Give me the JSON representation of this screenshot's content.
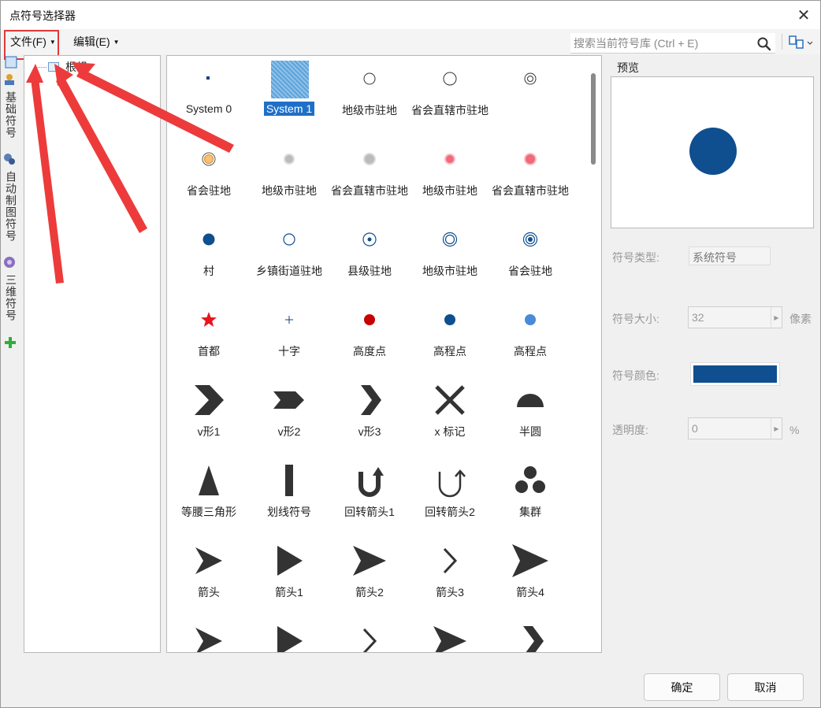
{
  "window": {
    "title": "点符号选择器",
    "close_glyph": "✕"
  },
  "menu": {
    "file": "文件(F)",
    "edit": "编辑(E)"
  },
  "search": {
    "placeholder": "搜索当前符号库 (Ctrl + E)"
  },
  "side_tabs": [
    {
      "label": "基础符号",
      "icon": "basic-symbol-icon"
    },
    {
      "label": "自动制图符号",
      "icon": "auto-mapping-icon"
    },
    {
      "label": "三维符号",
      "icon": "3d-symbol-icon"
    }
  ],
  "tree": {
    "root_label": "根组"
  },
  "symbols": [
    {
      "label": "System 0",
      "icon": "small-square",
      "selected": false
    },
    {
      "label": "System 1",
      "icon": "hatched-square",
      "selected": true
    },
    {
      "label": "地级市驻地",
      "icon": "circle-outline",
      "selected": false
    },
    {
      "label": "省会直辖市驻地",
      "icon": "circle-outline-large",
      "selected": false
    },
    {
      "label": "",
      "icon": "double-circle",
      "selected": false
    },
    {
      "label": "省会驻地",
      "icon": "orange-ring-circle",
      "selected": false
    },
    {
      "label": "地级市驻地",
      "icon": "gray-gradient-dot",
      "selected": false
    },
    {
      "label": "省会直辖市驻地",
      "icon": "gray-gradient-dot-large",
      "selected": false
    },
    {
      "label": "地级市驻地",
      "icon": "red-gradient-dot",
      "selected": false
    },
    {
      "label": "省会直辖市驻地",
      "icon": "red-gradient-dot-large",
      "selected": false
    },
    {
      "label": "村",
      "icon": "blue-filled-circle",
      "selected": false
    },
    {
      "label": "乡镇街道驻地",
      "icon": "blue-outline-circle",
      "selected": false
    },
    {
      "label": "县级驻地",
      "icon": "dot-in-circle",
      "selected": false
    },
    {
      "label": "地级市驻地",
      "icon": "concentric-circle",
      "selected": false
    },
    {
      "label": "省会驻地",
      "icon": "concentric-circle-dot",
      "selected": false
    },
    {
      "label": "首都",
      "icon": "red-star",
      "selected": false
    },
    {
      "label": "十字",
      "icon": "cross",
      "selected": false
    },
    {
      "label": "高度点",
      "icon": "red-dot",
      "selected": false
    },
    {
      "label": "高程点",
      "icon": "blue-dot",
      "selected": false
    },
    {
      "label": "高程点",
      "icon": "light-blue-dot",
      "selected": false
    },
    {
      "label": "v形1",
      "icon": "v-shape-1",
      "selected": false
    },
    {
      "label": "v形2",
      "icon": "v-shape-2",
      "selected": false
    },
    {
      "label": "v形3",
      "icon": "v-shape-3",
      "selected": false
    },
    {
      "label": "x 标记",
      "icon": "x-mark",
      "selected": false
    },
    {
      "label": "半圆",
      "icon": "half-circle",
      "selected": false
    },
    {
      "label": "等腰三角形",
      "icon": "isosceles-triangle",
      "selected": false
    },
    {
      "label": "划线符号",
      "icon": "dash-bar",
      "selected": false
    },
    {
      "label": "回转箭头1",
      "icon": "u-turn-arrow-1",
      "selected": false
    },
    {
      "label": "回转箭头2",
      "icon": "u-turn-arrow-2",
      "selected": false
    },
    {
      "label": "集群",
      "icon": "cluster",
      "selected": false
    },
    {
      "label": "箭头",
      "icon": "arrow-notched",
      "selected": false
    },
    {
      "label": "箭头1",
      "icon": "arrow-triangle",
      "selected": false
    },
    {
      "label": "箭头2",
      "icon": "arrow-concave",
      "selected": false
    },
    {
      "label": "箭头3",
      "icon": "arrow-chevron-thin",
      "selected": false
    },
    {
      "label": "箭头4",
      "icon": "arrow-concave-large",
      "selected": false
    },
    {
      "label": "",
      "icon": "arrow-notched",
      "selected": false
    },
    {
      "label": "",
      "icon": "arrow-triangle",
      "selected": false
    },
    {
      "label": "",
      "icon": "arrow-chevron-thin",
      "selected": false
    },
    {
      "label": "",
      "icon": "arrow-concave",
      "selected": false
    },
    {
      "label": "",
      "icon": "arrow-chevron-bold",
      "selected": false
    }
  ],
  "preview": {
    "label": "预览",
    "color": "#0f4f8f"
  },
  "properties": {
    "type_label": "符号类型:",
    "type_value": "系统符号",
    "size_label": "符号大小:",
    "size_value": "32",
    "size_unit": "像素",
    "color_label": "符号颜色:",
    "color_value": "#0f4f8f",
    "opacity_label": "透明度:",
    "opacity_value": "0",
    "opacity_unit": "%"
  },
  "buttons": {
    "ok": "确定",
    "cancel": "取消"
  },
  "annotation_color": "#e03a3a"
}
